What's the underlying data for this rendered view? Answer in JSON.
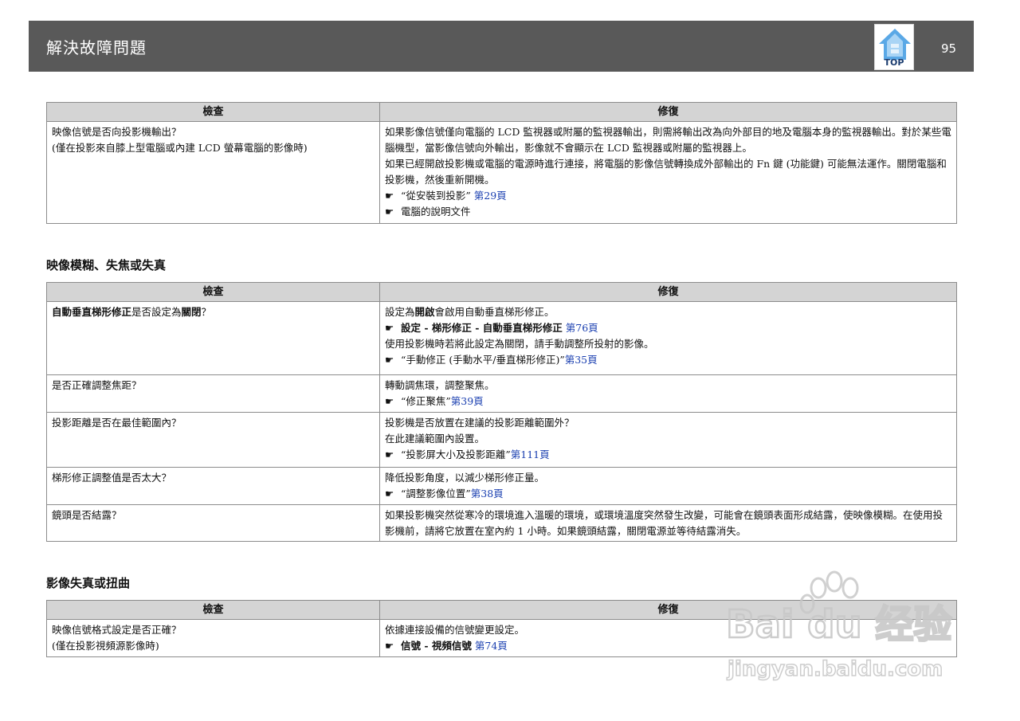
{
  "header": {
    "title": "解決故障問題",
    "top_label": "TOP",
    "page_number": "95"
  },
  "col_check": "檢查",
  "col_fix": "修復",
  "table1": {
    "r1": {
      "check_l1": "映像信號是否向投影機輸出？",
      "check_l2": "(僅在投影來自膝上型電腦或內建 LCD 螢幕電腦的影像時)",
      "fix_p1": "如果影像信號僅向電腦的 LCD 監視器或附屬的監視器輸出，則需將輸出改為向外部目的地及電腦本身的監視器輸出。對於某些電腦機型，當影像信號向外輸出，影像就不會顯示在 LCD 監視器或附屬的監視器上。",
      "fix_p2": "如果已經開啟投影機或電腦的電源時進行連接，將電腦的影像信號轉換成外部輸出的 Fn 鍵 (功能鍵) 可能無法運作。關閉電腦和投影機，然後重新開機。",
      "ref1_text": "“從安裝到投影”",
      "ref1_link": "第29頁",
      "ref2_text": "電腦的說明文件"
    }
  },
  "section2": {
    "title": "映像模糊、失焦或失真",
    "r1": {
      "check_b1": "自動垂直梯形修正",
      "check_t1": "是否設定為",
      "check_b2": "關閉",
      "check_t2": "？",
      "fix_t1": "設定為",
      "fix_b1": "開啟",
      "fix_t2": "會啟用自動垂直梯形修正。",
      "ref1_bold": "設定 - 梯形修正 - 自動垂直梯形修正",
      "ref1_link": "第76頁",
      "fix_p2": "使用投影機時若將此設定為關閉，請手動調整所投射的影像。",
      "ref2_text": "“手動修正 (手動水平/垂直梯形修正)”",
      "ref2_link": "第35頁"
    },
    "r2": {
      "check": "是否正確調整焦距？",
      "fix": "轉動調焦環，調整聚焦。",
      "ref_text": "“修正聚焦”",
      "ref_link": "第39頁"
    },
    "r3": {
      "check": "投影距離是否在最佳範圍內？",
      "fix_l1": "投影機是否放置在建議的投影距離範圍外？",
      "fix_l2": "在此建議範圍內設置。",
      "ref_text": "“投影屏大小及投影距離”",
      "ref_link": "第111頁"
    },
    "r4": {
      "check": "梯形修正調整值是否太大？",
      "fix": "降低投影角度，以減少梯形修正量。",
      "ref_text": "“調整影像位置”",
      "ref_link": "第38頁"
    },
    "r5": {
      "check": "鏡頭是否結露？",
      "fix": "如果投影機突然從寒冷的環境進入溫暖的環境，或環境溫度突然發生改變，可能會在鏡頭表面形成結露，使映像模糊。在使用投影機前，請將它放置在室內約 1 小時。如果鏡頭結露，關閉電源並等待結露消失。"
    }
  },
  "section3": {
    "title": "影像失真或扭曲",
    "r1": {
      "check_l1": "映像信號格式設定是否正確？",
      "check_l2": "(僅在投影視頻源影像時)",
      "fix": "依據連接設備的信號變更設定。",
      "ref_bold": "信號 - 視頻信號",
      "ref_link": "第74頁"
    }
  },
  "watermark": {
    "brand": "Bai du 经验",
    "url": "jingyan.baidu.com"
  },
  "colors": {
    "header_bg": "#595959",
    "table_header_bg": "#d4d4d4",
    "link": "#1a3fb0"
  }
}
